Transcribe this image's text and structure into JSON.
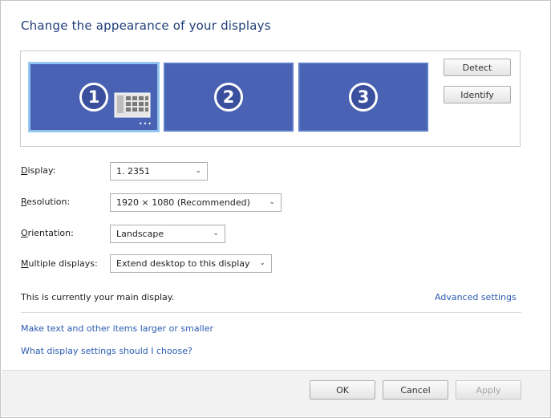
{
  "window": {
    "title": "Change the appearance of your displays"
  },
  "monitors": [
    {
      "number": "1",
      "selected": true
    },
    {
      "number": "2",
      "selected": false
    },
    {
      "number": "3",
      "selected": false
    }
  ],
  "monitor_panel": {
    "grip": "•••",
    "detect_label": "Detect",
    "identify_label": "Identify"
  },
  "settings": {
    "display": {
      "label": "Display:",
      "value": "1. 2351"
    },
    "resolution": {
      "label": "Resolution:",
      "value": "1920 × 1080 (Recommended)"
    },
    "orientation": {
      "label": "Orientation:",
      "value": "Landscape"
    },
    "multiple_displays": {
      "label": "Multiple displays:",
      "value": "Extend desktop to this display"
    }
  },
  "status": {
    "main_display_text": "This is currently your main display.",
    "advanced_settings_link": "Advanced settings"
  },
  "links": {
    "text_size": "Make text and other items larger or smaller",
    "help": "What display settings should I choose?"
  },
  "footer": {
    "ok_label": "OK",
    "cancel_label": "Cancel",
    "apply_label": "Apply"
  },
  "colors": {
    "monitor_fill": "#4a62b4",
    "selected_border": "#8fc2ee",
    "link": "#2a5bb0",
    "title": "#1f3e7a"
  }
}
